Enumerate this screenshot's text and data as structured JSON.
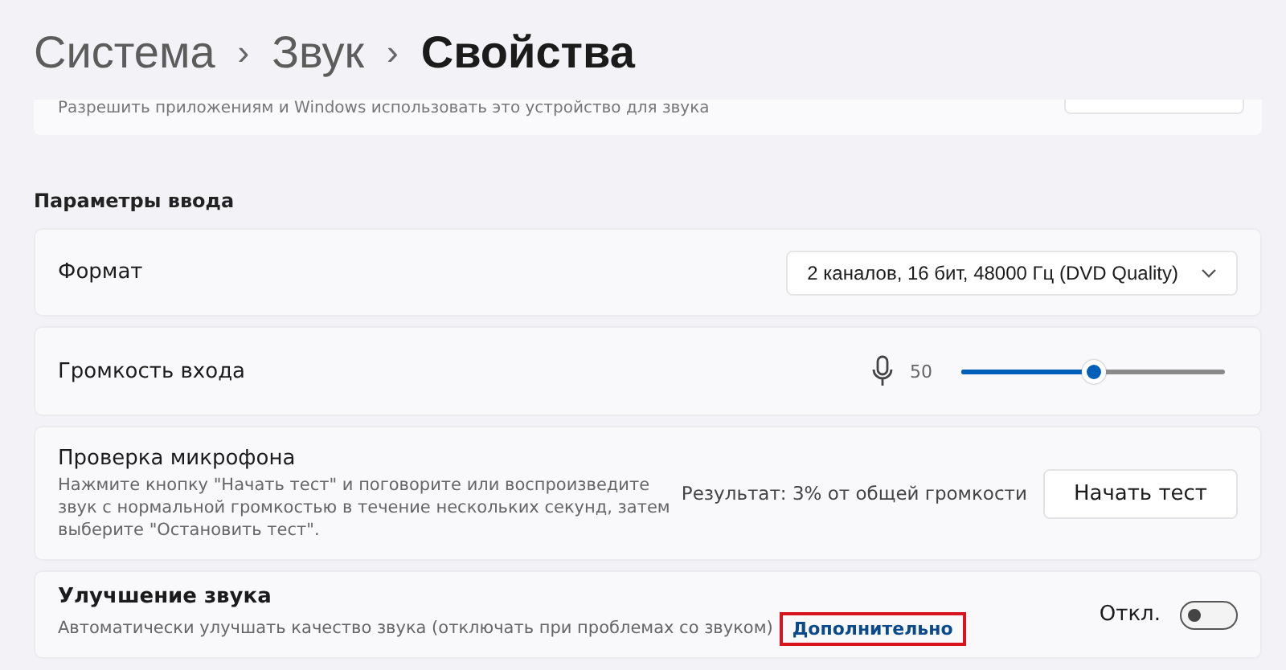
{
  "breadcrumb": [
    {
      "label": "Система",
      "current": false
    },
    {
      "label": "Звук",
      "current": false
    },
    {
      "label": "Свойства",
      "current": true
    }
  ],
  "breadcrumb_separator": "›",
  "top_card": {
    "description": "Разрешить приложениям и Windows использовать это устройство для звука"
  },
  "section_title": "Параметры ввода",
  "format": {
    "label": "Формат",
    "value": "2 каналов, 16 бит, 48000 Гц (DVD Quality)"
  },
  "volume": {
    "label": "Громкость входа",
    "reading": "50",
    "level": 0.5
  },
  "mic_test": {
    "title": "Проверка микрофона",
    "description": "Нажмите кнопку \"Начать тест\" и поговорите или воспроизведите звук с нормальной громкостью в течение нескольких секунд, затем выберите \"Остановить тест\".",
    "result": "Результат: 3% от общей громкости",
    "button": "Начать тест"
  },
  "enhancement": {
    "title": "Улучшение звука",
    "description": "Автоматически улучшать качество звука (отключать при проблемах со звуком)",
    "link": "Дополнительно",
    "link_highlighted": true,
    "state_label": "Откл.",
    "on": false
  }
}
